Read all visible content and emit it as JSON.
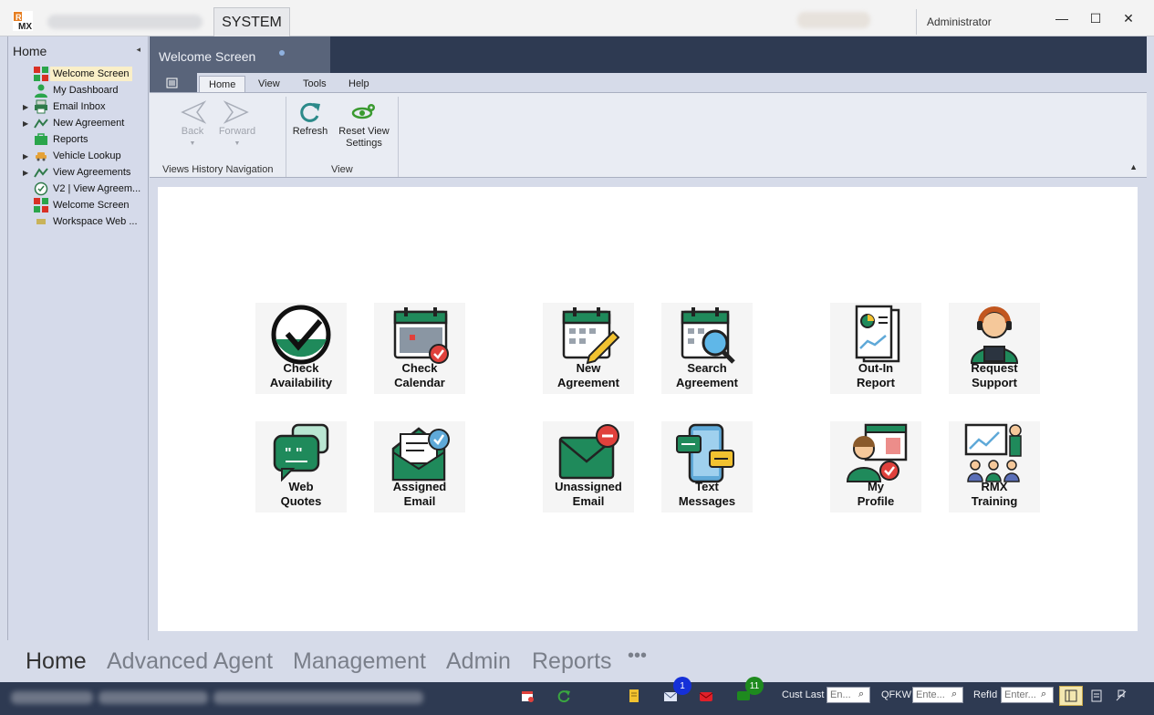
{
  "titlebar": {
    "system_tab": "SYSTEM",
    "user": "Administrator",
    "minimize": "—",
    "maximize": "☐",
    "close": "✕"
  },
  "nav": {
    "title": "Home",
    "collapse_icon": "◂",
    "items": [
      {
        "label": "Welcome Screen",
        "icon": "rmx-logo-icon",
        "expandable": false,
        "selected": true
      },
      {
        "label": "My Dashboard",
        "icon": "user-icon",
        "expandable": false
      },
      {
        "label": "Email Inbox",
        "icon": "printer-icon",
        "expandable": true
      },
      {
        "label": "New Agreement",
        "icon": "chart-line-icon",
        "expandable": true
      },
      {
        "label": "Reports",
        "icon": "briefcase-icon",
        "expandable": false
      },
      {
        "label": "Vehicle Lookup",
        "icon": "car-icon",
        "expandable": true
      },
      {
        "label": "View Agreements",
        "icon": "chart-line-icon",
        "expandable": true
      },
      {
        "label": "V2 | View Agreem...",
        "icon": "check-circle-icon",
        "expandable": false
      },
      {
        "label": "Welcome Screen",
        "icon": "rmx-logo-icon",
        "expandable": false
      },
      {
        "label": "Workspace Web ...",
        "icon": "map-icon",
        "expandable": false
      }
    ]
  },
  "doc_tab": {
    "label": "Welcome Screen"
  },
  "ribbon": {
    "tabs": [
      "Home",
      "View",
      "Tools",
      "Help"
    ],
    "active_tab": "Home",
    "buttons": {
      "back": "Back",
      "forward": "Forward",
      "refresh": "Refresh",
      "reset_line1": "Reset View",
      "reset_line2": "Settings"
    },
    "groups": {
      "history": "Views History Navigation",
      "view": "View"
    }
  },
  "tiles": [
    {
      "line1": "Check",
      "line2": "Availability",
      "icon": "check-availability-icon"
    },
    {
      "line1": "Check",
      "line2": "Calendar",
      "icon": "calendar-check-icon"
    },
    {
      "line1": "New",
      "line2": "Agreement",
      "icon": "calendar-pencil-icon"
    },
    {
      "line1": "Search",
      "line2": "Agreement",
      "icon": "calendar-search-icon"
    },
    {
      "line1": "Out-In",
      "line2": "Report",
      "icon": "report-icon"
    },
    {
      "line1": "Request",
      "line2": "Support",
      "icon": "support-agent-icon"
    },
    {
      "line1": "Web",
      "line2": "Quotes",
      "icon": "chat-bubbles-icon"
    },
    {
      "line1": "Assigned",
      "line2": "Email",
      "icon": "envelope-check-icon"
    },
    {
      "line1": "Unassigned",
      "line2": "Email",
      "icon": "envelope-minus-icon"
    },
    {
      "line1": "Text",
      "line2": "Messages",
      "icon": "phone-messages-icon"
    },
    {
      "line1": "My",
      "line2": "Profile",
      "icon": "profile-icon"
    },
    {
      "line1": "RMX",
      "line2": "Training",
      "icon": "training-icon"
    }
  ],
  "bottom_nav": [
    "Home",
    "Advanced Agent",
    "Management",
    "Admin",
    "Reports",
    "•••"
  ],
  "statusbar": {
    "email_badge": "1",
    "chat_badge": "11",
    "cust_last_label": "Cust Last",
    "cust_last_placeholder": "En...",
    "qfkw_label": "QFKW",
    "qfkw_placeholder": "Ente...",
    "refid_label": "RefId",
    "refid_placeholder": "Enter..."
  },
  "colors": {
    "brand_green": "#1f8a5b",
    "dark_navy": "#2e3a52",
    "accent_red": "#e0413c"
  }
}
